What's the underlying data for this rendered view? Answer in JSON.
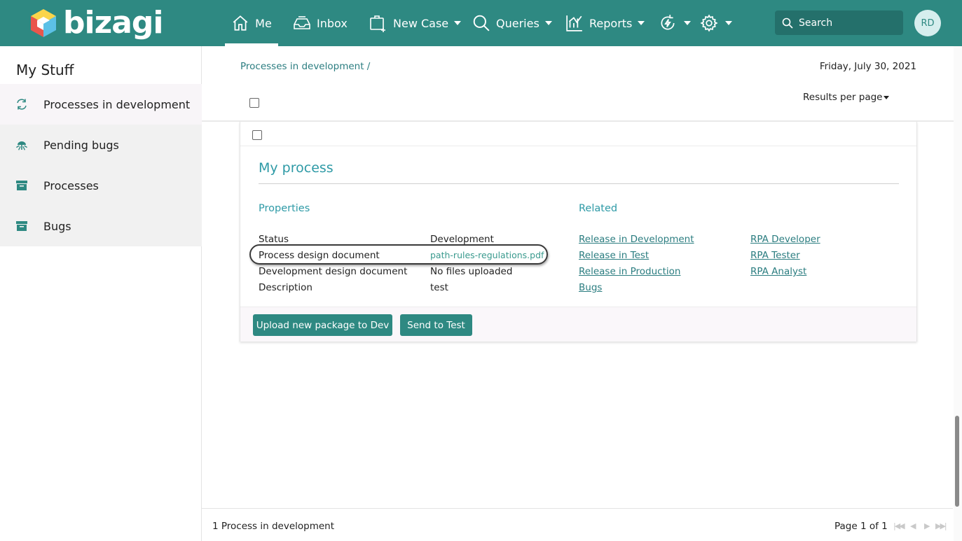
{
  "brand": {
    "name": "bizagi"
  },
  "nav": {
    "me": "Me",
    "inbox": "Inbox",
    "new_case": "New Case",
    "queries": "Queries",
    "reports": "Reports"
  },
  "search": {
    "placeholder": "Search"
  },
  "user": {
    "initials": "RD"
  },
  "sidebar": {
    "title": "My Stuff",
    "items": [
      {
        "label": "Processes in development",
        "icon": "refresh-icon"
      },
      {
        "label": "Pending bugs",
        "icon": "bug-icon"
      },
      {
        "label": "Processes",
        "icon": "archive-icon"
      },
      {
        "label": "Bugs",
        "icon": "archive-icon"
      }
    ]
  },
  "main": {
    "breadcrumb": "Processes in development /",
    "date": "Friday, July 30, 2021",
    "results_per_page": "Results per page"
  },
  "card": {
    "title": "My process",
    "properties_heading": "Properties",
    "related_heading": "Related",
    "properties": [
      {
        "label": "Status",
        "value": "Development"
      },
      {
        "label": "Process design document",
        "value": "path-rules-regulations.pdf"
      },
      {
        "label": "Development design document",
        "value": "No files uploaded"
      },
      {
        "label": "Description",
        "value": "test"
      }
    ],
    "related_left": [
      "Release in Development",
      "Release in Test",
      "Release in Production",
      "Bugs"
    ],
    "related_right": [
      "RPA Developer",
      "RPA Tester",
      "RPA Analyst"
    ],
    "buttons": {
      "upload": "Upload new package to Dev",
      "send": "Send to Test"
    }
  },
  "footer": {
    "count": "1 Process  in development",
    "page": "Page 1 of 1"
  },
  "colors": {
    "brand": "#2e8982",
    "link": "#2b7d80",
    "accent": "#2e9aa6"
  }
}
